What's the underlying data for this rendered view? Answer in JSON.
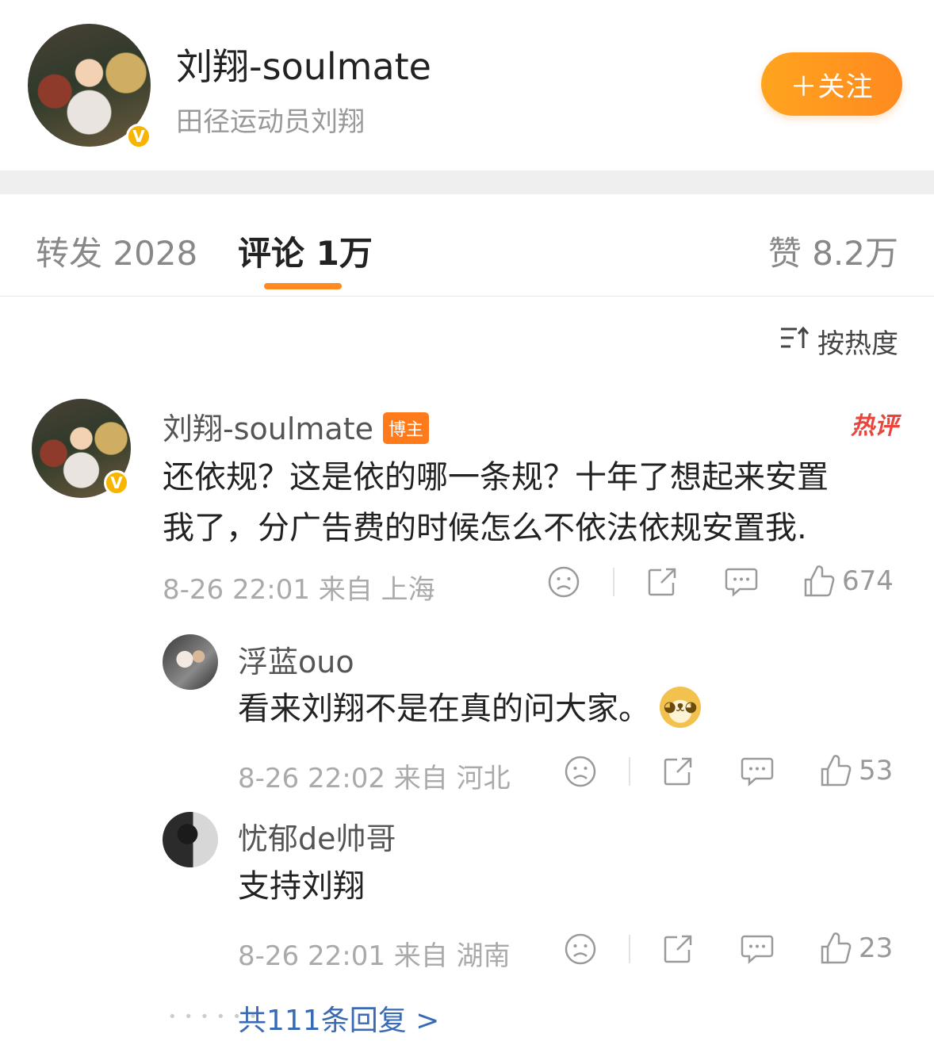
{
  "header": {
    "name": "刘翔-soulmate",
    "bio": "田径运动员刘翔",
    "follow_label": "＋关注",
    "verified_badge": "V"
  },
  "tabs": {
    "repost": "转发 2028",
    "comment": "评论 1万",
    "like": "赞 8.2万",
    "active": "comment"
  },
  "sort": {
    "icon": "sort-icon",
    "label": "按热度"
  },
  "colors": {
    "accent": "#ff8a1f",
    "verified": "#f7b500",
    "hot": "#e8453c",
    "link": "#3b6ab4"
  },
  "comment": {
    "user": "刘翔-soulmate",
    "owner_tag": "博主",
    "hot_tag": "热评",
    "text_line1": "还依规？这是依的哪一条规？十年了想起来安置",
    "text_line2": "我了，分广告费的时候怎么不依法依规安置我.",
    "meta": "8-26 22:01 来自 上海",
    "likes": "674"
  },
  "replies": [
    {
      "user": "浮蓝ouo",
      "text": "看来刘翔不是在真的问大家。",
      "emoji": "doge-emoji",
      "meta": "8-26 22:02 来自 河北",
      "likes": "53"
    },
    {
      "user": "忧郁de帅哥",
      "text": "支持刘翔",
      "meta": "8-26 22:01 来自 湖南",
      "likes": "23"
    }
  ],
  "more_replies": "共111条回复 >"
}
